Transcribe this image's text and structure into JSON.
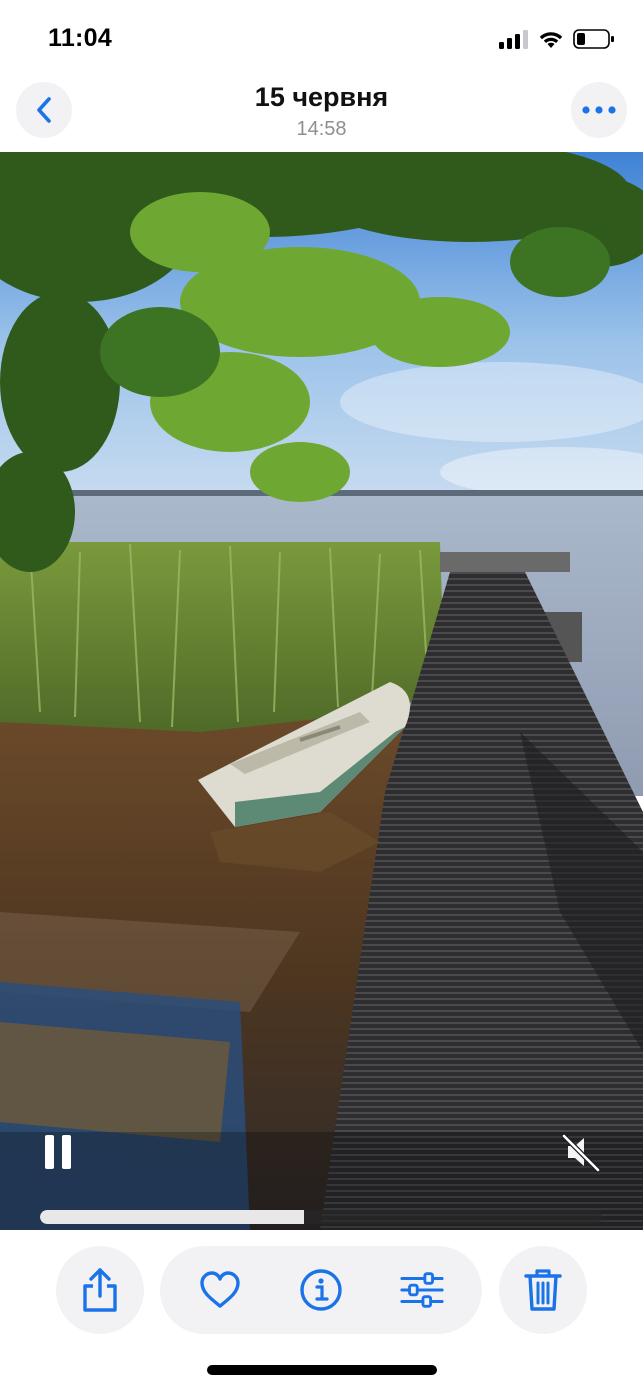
{
  "status_bar": {
    "time": "11:04",
    "icons": [
      "signal-icon",
      "wifi-icon",
      "battery-icon"
    ]
  },
  "header": {
    "title": "15 червня",
    "subtitle": "14:58",
    "back_icon": "chevron-left-icon",
    "more_icon": "ellipsis-icon"
  },
  "player": {
    "state": "playing",
    "muted": true,
    "progress": 0.47,
    "pause_icon": "pause-icon",
    "mute_icon": "speaker-muted-icon"
  },
  "toolbar": {
    "items": [
      "share-icon",
      "heart-icon",
      "info-icon",
      "adjust-icon",
      "trash-icon"
    ],
    "accent": "#1a73e8"
  },
  "colors": {
    "accent": "#1a73e8",
    "button_bg": "#f2f2f5"
  }
}
